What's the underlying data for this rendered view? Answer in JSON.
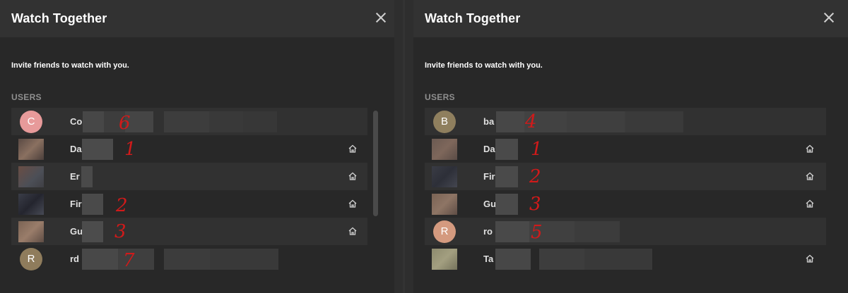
{
  "left": {
    "title": "Watch Together",
    "subtitle": "Invite friends to watch with you.",
    "section": "USERS",
    "users": [
      {
        "initial": "C",
        "name": "Co",
        "mark": "6",
        "home": false
      },
      {
        "initial": "",
        "name": "Da",
        "mark": "1",
        "home": true
      },
      {
        "initial": "",
        "name": "Er",
        "mark": "",
        "home": true
      },
      {
        "initial": "",
        "name": "Fir",
        "mark": "2",
        "home": true
      },
      {
        "initial": "",
        "name": "Gu",
        "mark": "3",
        "home": true
      },
      {
        "initial": "R",
        "name": "rd",
        "mark": "7",
        "home": false
      }
    ]
  },
  "right": {
    "title": "Watch Together",
    "subtitle": "Invite friends to watch with you.",
    "section": "USERS",
    "users": [
      {
        "initial": "B",
        "name": "ba",
        "mark": "4",
        "home": false
      },
      {
        "initial": "",
        "name": "Da",
        "mark": "1",
        "home": true
      },
      {
        "initial": "",
        "name": "Fir",
        "mark": "2",
        "home": true
      },
      {
        "initial": "",
        "name": "Gu",
        "mark": "3",
        "home": true
      },
      {
        "initial": "R",
        "name": "ro",
        "mark": "5",
        "home": false
      },
      {
        "initial": "",
        "name": "Ta",
        "mark": "",
        "home": true
      }
    ]
  },
  "icons": {
    "close": "close-icon",
    "home": "home-icon"
  },
  "colors": {
    "background": "#282828",
    "header": "#323232",
    "row": "#313131",
    "annotation": "#d11a1a"
  }
}
